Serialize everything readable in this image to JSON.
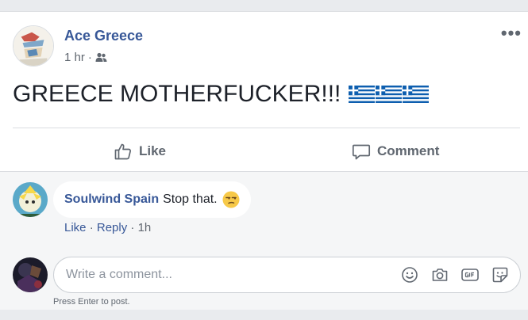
{
  "post": {
    "author": "Ace Greece",
    "time": "1 hr",
    "separator": "·",
    "audience_icon": "friends-icon",
    "more_label": "•••",
    "text": "GREECE MOTHERFUCKER!!!",
    "flag_icons": [
      "greece-flag-icon",
      "greece-flag-icon",
      "greece-flag-icon"
    ]
  },
  "actions": {
    "like_label": "Like",
    "comment_label": "Comment"
  },
  "comment": {
    "author": "Soulwind Spain",
    "text": "Stop that.",
    "emoji_icon": "unamused-face-icon",
    "like_label": "Like",
    "separator": "·",
    "reply_label": "Reply",
    "time": "1h"
  },
  "composer": {
    "placeholder": "Write a comment...",
    "hint": "Press Enter to post.",
    "icons": [
      "emoji-icon",
      "camera-icon",
      "gif-icon",
      "sticker-icon"
    ]
  },
  "colors": {
    "link_blue": "#385898",
    "secondary_text": "#606770",
    "greek_blue": "#0d5eaf"
  }
}
